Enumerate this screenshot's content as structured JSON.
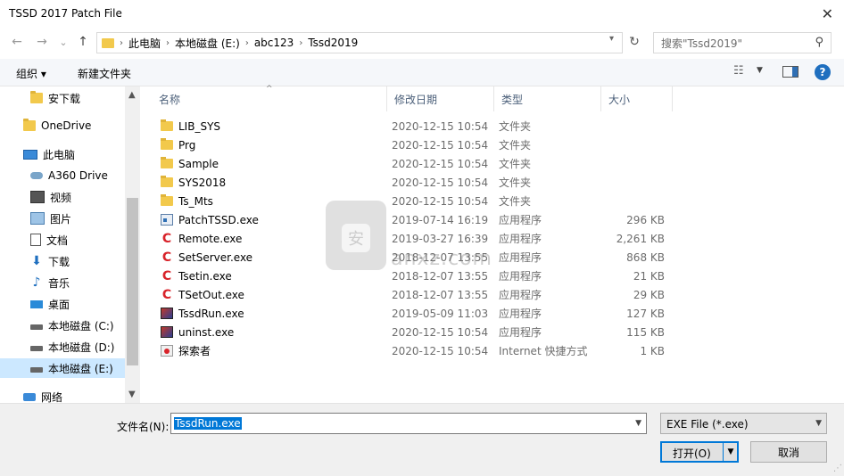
{
  "window": {
    "title": "TSSD 2017 Patch File",
    "close_glyph": "✕"
  },
  "nav": {
    "back": "←",
    "forward": "→",
    "recent": "⌄",
    "up": "↑"
  },
  "address": {
    "segments": [
      "此电脑",
      "本地磁盘 (E:)",
      "abc123",
      "Tssd2019"
    ]
  },
  "search": {
    "placeholder": "搜索\"Tssd2019\""
  },
  "toolbar": {
    "organize": "组织 ▾",
    "new_folder": "新建文件夹"
  },
  "sidebar": {
    "items": [
      {
        "label": "安下载",
        "icon": "folder-icon"
      },
      {
        "label": "OneDrive",
        "icon": "folder-icon"
      },
      {
        "label": "此电脑",
        "icon": "pc-icon"
      },
      {
        "label": "A360 Drive",
        "icon": "cloud-icon"
      },
      {
        "label": "视频",
        "icon": "video-icon"
      },
      {
        "label": "图片",
        "icon": "image-icon"
      },
      {
        "label": "文档",
        "icon": "document-icon"
      },
      {
        "label": "下载",
        "icon": "download-icon"
      },
      {
        "label": "音乐",
        "icon": "music-icon"
      },
      {
        "label": "桌面",
        "icon": "desktop-icon"
      },
      {
        "label": "本地磁盘 (C:)",
        "icon": "drive-icon"
      },
      {
        "label": "本地磁盘 (D:)",
        "icon": "drive-icon"
      },
      {
        "label": "本地磁盘 (E:)",
        "icon": "drive-icon",
        "selected": true
      },
      {
        "label": "网络",
        "icon": "network-icon"
      }
    ]
  },
  "columns": {
    "name": "名称",
    "date": "修改日期",
    "type": "类型",
    "size": "大小"
  },
  "files": [
    {
      "name": "LIB_SYS",
      "date": "2020-12-15 10:54",
      "type": "文件夹",
      "size": "",
      "icon": "folder-icon"
    },
    {
      "name": "Prg",
      "date": "2020-12-15 10:54",
      "type": "文件夹",
      "size": "",
      "icon": "folder-icon"
    },
    {
      "name": "Sample",
      "date": "2020-12-15 10:54",
      "type": "文件夹",
      "size": "",
      "icon": "folder-icon"
    },
    {
      "name": "SYS2018",
      "date": "2020-12-15 10:54",
      "type": "文件夹",
      "size": "",
      "icon": "folder-icon"
    },
    {
      "name": "Ts_Mts",
      "date": "2020-12-15 10:54",
      "type": "文件夹",
      "size": "",
      "icon": "folder-icon"
    },
    {
      "name": "PatchTSSD.exe",
      "date": "2019-07-14 16:19",
      "type": "应用程序",
      "size": "296 KB",
      "icon": "app-icon"
    },
    {
      "name": "Remote.exe",
      "date": "2019-03-27 16:39",
      "type": "应用程序",
      "size": "2,261 KB",
      "icon": "red-c-icon"
    },
    {
      "name": "SetServer.exe",
      "date": "2018-12-07 13:55",
      "type": "应用程序",
      "size": "868 KB",
      "icon": "red-c-icon"
    },
    {
      "name": "Tsetin.exe",
      "date": "2018-12-07 13:55",
      "type": "应用程序",
      "size": "21 KB",
      "icon": "red-c-icon"
    },
    {
      "name": "TSetOut.exe",
      "date": "2018-12-07 13:55",
      "type": "应用程序",
      "size": "29 KB",
      "icon": "red-c-icon"
    },
    {
      "name": "TssdRun.exe",
      "date": "2019-05-09 11:03",
      "type": "应用程序",
      "size": "127 KB",
      "icon": "tssd-icon"
    },
    {
      "name": "uninst.exe",
      "date": "2020-12-15 10:54",
      "type": "应用程序",
      "size": "115 KB",
      "icon": "tssd-icon"
    },
    {
      "name": "探索者",
      "date": "2020-12-15 10:54",
      "type": "Internet 快捷方式",
      "size": "1 KB",
      "icon": "shortcut-icon"
    }
  ],
  "watermark": {
    "text": "anxz.com"
  },
  "footer": {
    "filename_label": "文件名(N):",
    "filename_value": "TssdRun.exe",
    "filter_value": "EXE File (*.exe)",
    "open_label": "打开(O)",
    "cancel_label": "取消"
  },
  "colors": {
    "accent": "#0078d7",
    "selection": "#cce8ff",
    "folder": "#f2c94c"
  }
}
